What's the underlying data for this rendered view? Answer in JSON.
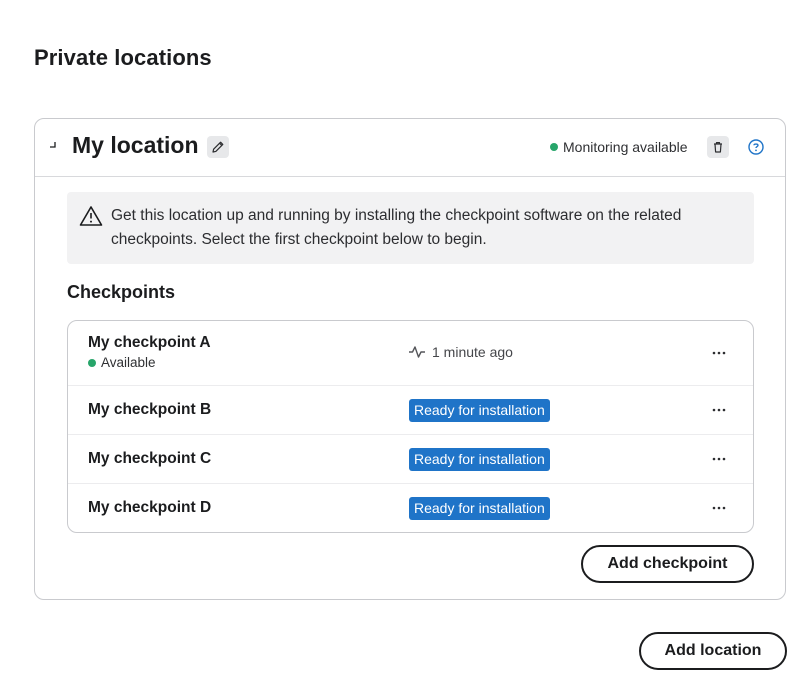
{
  "page": {
    "title": "Private locations"
  },
  "location": {
    "name": "My location",
    "status": "Monitoring available",
    "status_color": "#27a56a",
    "icons": {
      "collapse": "collapse-icon",
      "edit": "pencil-icon",
      "delete": "trash-icon",
      "help": "help-icon"
    }
  },
  "alert": {
    "icon": "warning-icon",
    "text": "Get this location up and running by installing the checkpoint software on the related checkpoints. Select the first checkpoint below to begin."
  },
  "checkpoints": {
    "heading": "Checkpoints",
    "rows": [
      {
        "name": "My checkpoint A",
        "status": "Available",
        "activity": "1 minute ago",
        "badge": ""
      },
      {
        "name": "My checkpoint B",
        "status": "",
        "activity": "",
        "badge": "Ready for installation"
      },
      {
        "name": "My checkpoint C",
        "status": "",
        "activity": "",
        "badge": "Ready for installation"
      },
      {
        "name": "My checkpoint D",
        "status": "",
        "activity": "",
        "badge": "Ready for installation"
      }
    ],
    "badge_color": "#1f74c8",
    "row_action_icon": "more-horizontal-icon"
  },
  "actions": {
    "add_checkpoint": "Add checkpoint",
    "add_location": "Add location"
  }
}
